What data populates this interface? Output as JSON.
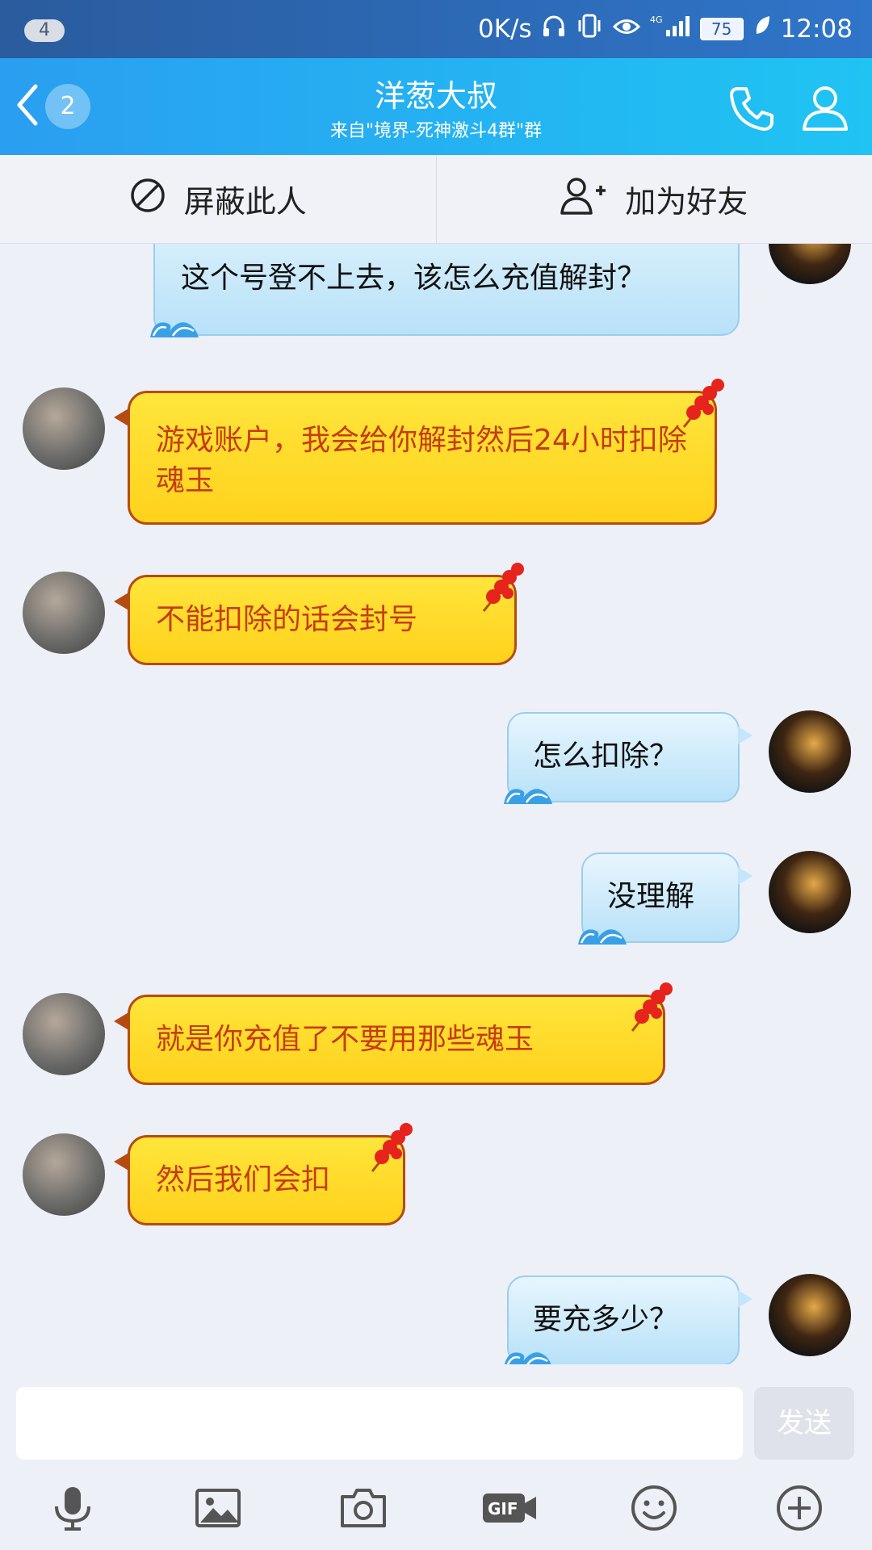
{
  "status_bar": {
    "notification_count": "4",
    "net_speed": "0K/s",
    "signal_label": "4G",
    "battery": "75",
    "time": "12:08"
  },
  "header": {
    "back_count": "2",
    "title": "洋葱大叔",
    "subtitle": "来自\"境界-死神激斗4群\"群"
  },
  "actions": {
    "block_label": "屏蔽此人",
    "add_friend_label": "加为好友"
  },
  "messages": [
    {
      "side": "out",
      "text": "这个号登不上去，该怎么充值解封？"
    },
    {
      "side": "in",
      "text": "游戏账户，我会给你解封然后24小时扣除魂玉"
    },
    {
      "side": "in",
      "text": "不能扣除的话会封号"
    },
    {
      "side": "out",
      "text": "怎么扣除？"
    },
    {
      "side": "out",
      "text": "没理解"
    },
    {
      "side": "in",
      "text": "就是你充值了不要用那些魂玉"
    },
    {
      "side": "in",
      "text": "然后我们会扣"
    },
    {
      "side": "out",
      "text": "要充多少？"
    }
  ],
  "composer": {
    "input_value": "",
    "send_label": "发送"
  },
  "icons": {
    "back": "chevron-left-icon",
    "phone": "phone-icon",
    "profile": "profile-icon",
    "block": "block-icon",
    "add_friend": "add-friend-icon",
    "mic": "mic-icon",
    "image": "image-icon",
    "camera": "camera-icon",
    "gif": "gif-icon",
    "emoji": "emoji-icon",
    "plus": "plus-icon"
  },
  "colors": {
    "header": "#22b0f2",
    "incoming_bubble": "#ffd21c",
    "incoming_text": "#c63d10",
    "outgoing_bubble": "#c4e6fb"
  }
}
